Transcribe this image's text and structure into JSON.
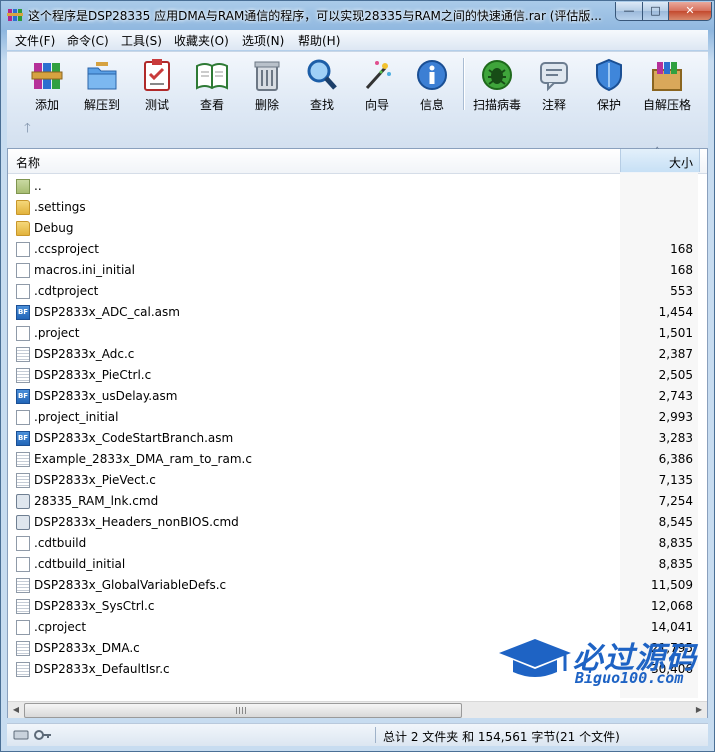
{
  "window": {
    "title": "这个程序是DSP28335 应用DMA与RAM通信的程序，可以实现28335与RAM之间的快速通信.rar (评估版...",
    "buttons": {
      "minimize": "—",
      "maximize": "□",
      "close": "✕"
    }
  },
  "menu": [
    "文件(F)",
    "命令(C)",
    "工具(S)",
    "收藏夹(O)",
    "选项(N)",
    "帮助(H)"
  ],
  "toolbar": {
    "tools": [
      {
        "label": "添加",
        "icon": "add-icon"
      },
      {
        "label": "解压到",
        "icon": "extract-to-icon"
      },
      {
        "label": "测试",
        "icon": "test-icon"
      },
      {
        "label": "查看",
        "icon": "view-icon"
      },
      {
        "label": "删除",
        "icon": "delete-icon"
      },
      {
        "label": "查找",
        "icon": "find-icon"
      },
      {
        "label": "向导",
        "icon": "wizard-icon"
      },
      {
        "label": "信息",
        "icon": "info-icon"
      },
      {
        "label": "扫描病毒",
        "icon": "virus-scan-icon"
      },
      {
        "label": "注释",
        "icon": "comment-icon"
      },
      {
        "label": "保护",
        "icon": "protect-icon"
      },
      {
        "label": "自解压格",
        "icon": "sfx-icon"
      }
    ],
    "up_arrow": "🡑"
  },
  "list": {
    "columns": {
      "name": "名称",
      "size": "大小"
    },
    "sort_indicator": "˄",
    "rows": [
      {
        "name": "..",
        "size": "",
        "type": "folder-up"
      },
      {
        "name": ".settings",
        "size": "",
        "type": "folder"
      },
      {
        "name": "Debug",
        "size": "",
        "type": "folder"
      },
      {
        "name": ".ccsproject",
        "size": "168",
        "type": "file"
      },
      {
        "name": "macros.ini_initial",
        "size": "168",
        "type": "file"
      },
      {
        "name": ".cdtproject",
        "size": "553",
        "type": "file"
      },
      {
        "name": "DSP2833x_ADC_cal.asm",
        "size": "1,454",
        "type": "asm"
      },
      {
        "name": ".project",
        "size": "1,501",
        "type": "file"
      },
      {
        "name": "DSP2833x_Adc.c",
        "size": "2,387",
        "type": "text"
      },
      {
        "name": "DSP2833x_PieCtrl.c",
        "size": "2,505",
        "type": "text"
      },
      {
        "name": "DSP2833x_usDelay.asm",
        "size": "2,743",
        "type": "asm"
      },
      {
        "name": ".project_initial",
        "size": "2,993",
        "type": "file"
      },
      {
        "name": "DSP2833x_CodeStartBranch.asm",
        "size": "3,283",
        "type": "asm"
      },
      {
        "name": "Example_2833x_DMA_ram_to_ram.c",
        "size": "6,386",
        "type": "text"
      },
      {
        "name": "DSP2833x_PieVect.c",
        "size": "7,135",
        "type": "text"
      },
      {
        "name": "28335_RAM_lnk.cmd",
        "size": "7,254",
        "type": "cmd"
      },
      {
        "name": "DSP2833x_Headers_nonBIOS.cmd",
        "size": "8,545",
        "type": "cmd"
      },
      {
        "name": ".cdtbuild",
        "size": "8,835",
        "type": "file"
      },
      {
        "name": ".cdtbuild_initial",
        "size": "8,835",
        "type": "file"
      },
      {
        "name": "DSP2833x_GlobalVariableDefs.c",
        "size": "11,509",
        "type": "text"
      },
      {
        "name": "DSP2833x_SysCtrl.c",
        "size": "12,068",
        "type": "text"
      },
      {
        "name": ".cproject",
        "size": "14,041",
        "type": "file"
      },
      {
        "name": "DSP2833x_DMA.c",
        "size": "21,795",
        "type": "text"
      },
      {
        "name": "DSP2833x_DefaultIsr.c",
        "size": "30,406",
        "type": "text"
      }
    ]
  },
  "status": {
    "summary": "总计 2 文件夹 和 154,561 字节(21 个文件)"
  },
  "watermark": {
    "main": "必过源码",
    "sub": "Biguo100.com"
  }
}
